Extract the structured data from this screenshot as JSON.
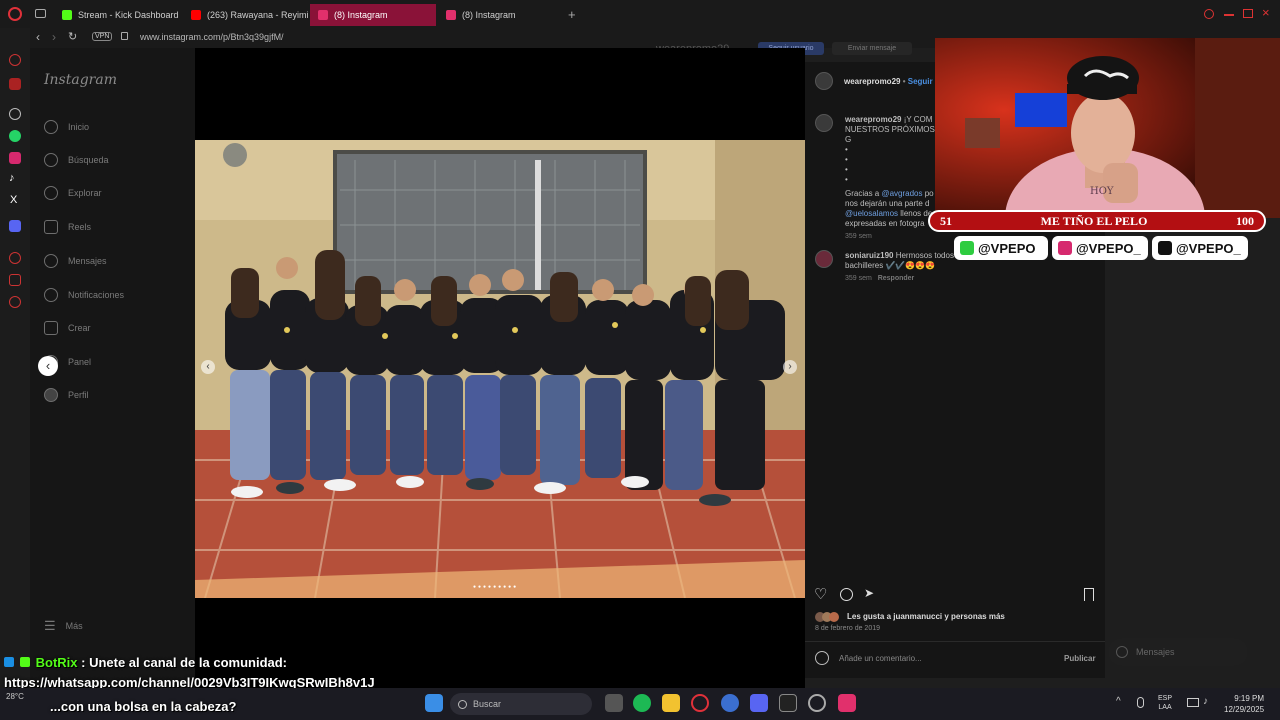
{
  "browser": {
    "tabs": [
      {
        "label": "Stream - Kick Dashboard",
        "color": "#53fc18"
      },
      {
        "label": "(263) Rawayana - Reyimil",
        "color": "#ff0000"
      },
      {
        "label": "(8) Instagram",
        "color": "#e1306c"
      },
      {
        "label": "(8) Instagram",
        "color": "#e1306c"
      }
    ],
    "vpn": "VPN",
    "url": "www.instagram.com/p/Btn3q39gjfM/"
  },
  "instagram": {
    "logo": "Instagram",
    "nav": [
      "Inicio",
      "Búsqueda",
      "Explorar",
      "Reels",
      "Mensajes",
      "Notificaciones",
      "Crear",
      "Panel",
      "Perfil"
    ],
    "more": "Más",
    "bg_header": "wearepromo29",
    "bg_follow": "Seguir usuario",
    "bg_message": "Enviar mensaje",
    "post": {
      "username": "wearepromo29",
      "follow": "Seguir",
      "caption_user": "wearepromo29",
      "caption_l1": "¡Y COM",
      "caption_l2": "NUESTROS PRÓXIMOS G",
      "caption_dots": "•",
      "caption_l3a": "Gracias a ",
      "caption_l3b": "@avgrados",
      "caption_l3c": " po",
      "caption_l4": "nos dejarán una parte d",
      "caption_l5a": "@uelosalamos",
      "caption_l5b": " llenos de",
      "caption_l6": "expresadas en fotogra",
      "caption_time": "359 sem",
      "comment_user": "soniaruiz190",
      "comment_l1": " Hermosos todos",
      "comment_l2": "bachilleres ✔️✔️😍😍😍",
      "comment_time": "359 sem",
      "comment_reply": "Responder",
      "likes": "Les gusta a juanmanucci y personas más",
      "date": "8 de febrero de 2019",
      "comment_placeholder": "Añade un comentario...",
      "publish": "Publicar",
      "messages": "Mensajes"
    }
  },
  "overlay": {
    "goal_left": "51",
    "goal_title": "ME TIÑO EL PELO",
    "goal_right": "100",
    "kick": "@VPEPO",
    "instagram": "@VPEPO_",
    "tiktok": "@VPEPO_",
    "cap_text": "HOY"
  },
  "chat": {
    "bot_name": "BotRix",
    "line1": " : Unete al canal de la comunidad:",
    "line2": "https://whatsapp.com/channel/0029Vb3IT9IKwqSRwIBh8v1J",
    "line3": "...con una bolsa en la cabeza?"
  },
  "taskbar": {
    "weather": "28°C",
    "search": "Buscar",
    "lang1": "ESP",
    "lang2": "LAA",
    "time": "9:19 PM",
    "date": "12/29/2025"
  }
}
